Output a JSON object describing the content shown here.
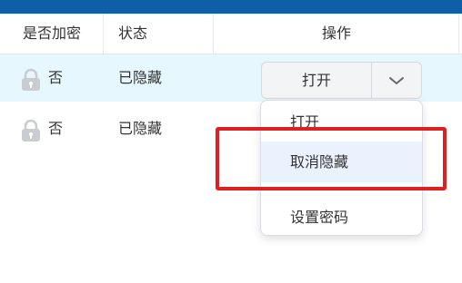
{
  "table": {
    "headers": {
      "encrypted": "是否加密",
      "status": "状态",
      "action": "操作"
    },
    "rows": [
      {
        "encrypted": "否",
        "status": "已隐藏",
        "action_label": "打开"
      },
      {
        "encrypted": "否",
        "status": "已隐藏"
      }
    ]
  },
  "dropdown": {
    "items": [
      "打开",
      "取消隐藏",
      "设置密码"
    ],
    "highlighted": "取消隐藏"
  },
  "colors": {
    "top_strip": "#0e5fa6",
    "selected_row": "#e6f7fd",
    "highlight_border": "#e02020",
    "hovered_item": "#e9f2fd"
  },
  "icons": {
    "lock": "lock-icon",
    "toggle": "chevron-down-icon"
  }
}
